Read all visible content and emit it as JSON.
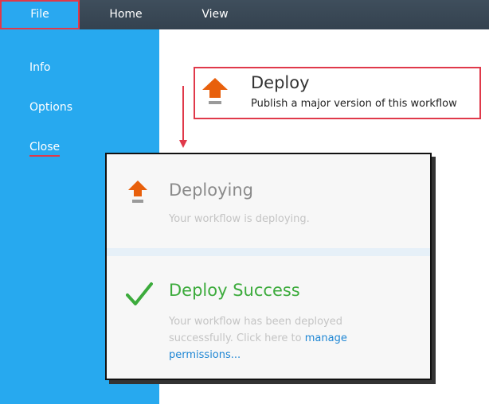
{
  "menubar": {
    "tabs": [
      {
        "label": "File"
      },
      {
        "label": "Home"
      },
      {
        "label": "View"
      }
    ]
  },
  "sidebar": {
    "items": [
      {
        "label": "Info"
      },
      {
        "label": "Options"
      },
      {
        "label": "Close"
      }
    ]
  },
  "deploy": {
    "title": "Deploy",
    "subtitle": "Publish a major version of this workflow",
    "icon": "deploy-upload-icon"
  },
  "status_panel": {
    "deploying": {
      "title": "Deploying",
      "message": "Your workflow is deploying.",
      "icon": "deploy-upload-icon"
    },
    "success": {
      "title": "Deploy Success",
      "message_prefix": "Your workflow has been deployed successfully. Click here to",
      "link_text": "manage permissions...",
      "icon": "checkmark-icon"
    }
  },
  "colors": {
    "menubar": "#3a4856",
    "accent_blue": "#27a9ef",
    "highlight_red": "#e0394a",
    "success_green": "#3cab3c",
    "link_blue": "#1e86d4",
    "deploy_orange": "#e8600c"
  }
}
